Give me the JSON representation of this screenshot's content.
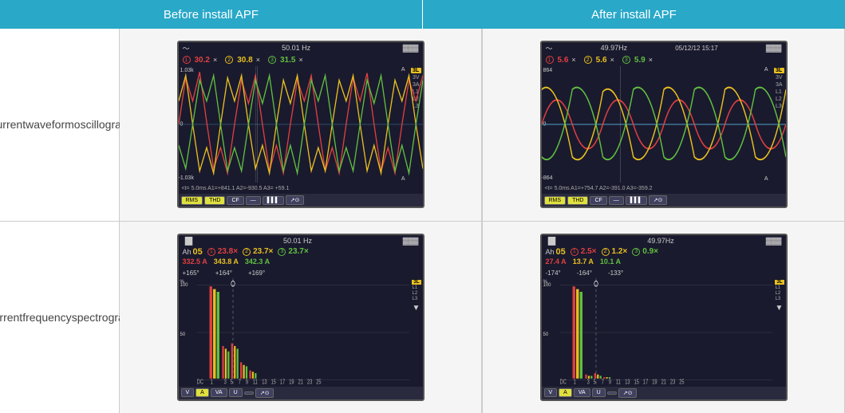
{
  "header": {
    "before_label": "Before install APF",
    "after_label": "After install APF"
  },
  "labels": {
    "row1_line1": "Current",
    "row1_line2": "waveform",
    "row1_line3": "oscillogram",
    "row2_line1": "Current",
    "row2_line2": "frequency",
    "row2_line3": "spectrogram"
  },
  "before_waveform": {
    "hz": "50.01 Hz",
    "battery": "▓▓▓",
    "p1_val": "30.2",
    "p2_val": "30.8",
    "p3_val": "31.5",
    "pct": "×",
    "y_top": "1.03k",
    "y_zero": "0",
    "y_bot": "-1.03k",
    "bottom_text": "<t= 5.0ms  A1=+841.1  A2=-930.5  A3= +59.1",
    "footer_buttons": [
      "RMS",
      "THD",
      "CF",
      "—",
      "▓▓▓",
      "↗"
    ]
  },
  "after_waveform": {
    "hz": "49.97Hz",
    "date": "05/12/12 15:17",
    "battery": "▓▓▓",
    "p1_val": "5.6",
    "p2_val": "5.6",
    "p3_val": "5.9",
    "pct": "×",
    "y_top": "864",
    "y_zero": "0",
    "y_bot": "-864",
    "bottom_text": "<t= 5.0ms  A1=+754.7  A2=-391.0  A3=-359.2",
    "footer_buttons": [
      "RMS",
      "THD",
      "CF",
      "—",
      "▓▓▓",
      "↗"
    ]
  },
  "before_spectrogram": {
    "hz": "50.01 Hz",
    "battery": "▓▓▓",
    "ah": "Ah 05",
    "p1_pct": "23.8×",
    "p2_pct": "23.7×",
    "p3_pct": "23.7×",
    "p1_amp": "332.5 A",
    "p1_angle": "+165°",
    "p2_amp": "343.8 A",
    "p2_angle": "+164°",
    "p3_amp": "342.3 A",
    "p3_angle": "+169°",
    "footer_buttons": [
      "V",
      "A",
      "VA",
      "U",
      "",
      "↗"
    ]
  },
  "after_spectrogram": {
    "hz": "49.97Hz",
    "battery": "▓▓▓",
    "ah": "Ah 05",
    "p1_pct": "2.5×",
    "p2_pct": "1.2×",
    "p3_pct": "0.9×",
    "p1_amp": "27.4 A",
    "p1_angle": "-174°",
    "p2_amp": "13.7 A",
    "p2_angle": "-164°",
    "p3_amp": "10.1 A",
    "p3_angle": "-133°",
    "footer_buttons": [
      "V",
      "A",
      "VA",
      "U",
      "",
      "↗"
    ]
  }
}
